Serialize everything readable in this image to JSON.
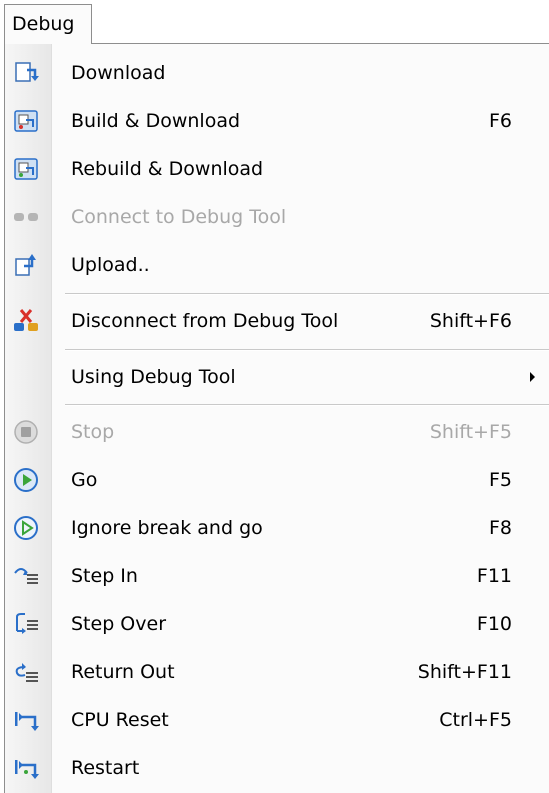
{
  "menubar": {
    "title": "Debug"
  },
  "menu": {
    "items": [
      {
        "label": "Download",
        "shortcut": "",
        "icon": "download-icon",
        "enabled": true
      },
      {
        "label": "Build & Download",
        "shortcut": "F6",
        "icon": "build-download-icon",
        "enabled": true
      },
      {
        "label": "Rebuild & Download",
        "shortcut": "",
        "icon": "rebuild-download-icon",
        "enabled": true
      },
      {
        "label": "Connect to Debug Tool",
        "shortcut": "",
        "icon": "connect-icon",
        "enabled": false
      },
      {
        "label": "Upload..",
        "shortcut": "",
        "icon": "upload-icon",
        "enabled": true
      },
      {
        "label": "Disconnect from Debug Tool",
        "shortcut": "Shift+F6",
        "icon": "disconnect-icon",
        "enabled": true
      },
      {
        "label": "Using Debug Tool",
        "shortcut": "",
        "icon": "",
        "enabled": true,
        "submenu": true
      },
      {
        "label": "Stop",
        "shortcut": "Shift+F5",
        "icon": "stop-icon",
        "enabled": false
      },
      {
        "label": "Go",
        "shortcut": "F5",
        "icon": "go-icon",
        "enabled": true
      },
      {
        "label": "Ignore break and go",
        "shortcut": "F8",
        "icon": "ignore-break-go-icon",
        "enabled": true
      },
      {
        "label": "Step In",
        "shortcut": "F11",
        "icon": "step-in-icon",
        "enabled": true
      },
      {
        "label": "Step Over",
        "shortcut": "F10",
        "icon": "step-over-icon",
        "enabled": true
      },
      {
        "label": "Return Out",
        "shortcut": "Shift+F11",
        "icon": "return-out-icon",
        "enabled": true
      },
      {
        "label": "CPU Reset",
        "shortcut": "Ctrl+F5",
        "icon": "cpu-reset-icon",
        "enabled": true
      },
      {
        "label": "Restart",
        "shortcut": "",
        "icon": "restart-icon",
        "enabled": true
      }
    ]
  },
  "colors": {
    "disabled_text": "#a8a8a8",
    "icon_blue": "#2a6fc9",
    "icon_green": "#3aa53a",
    "icon_red": "#d9302a"
  }
}
